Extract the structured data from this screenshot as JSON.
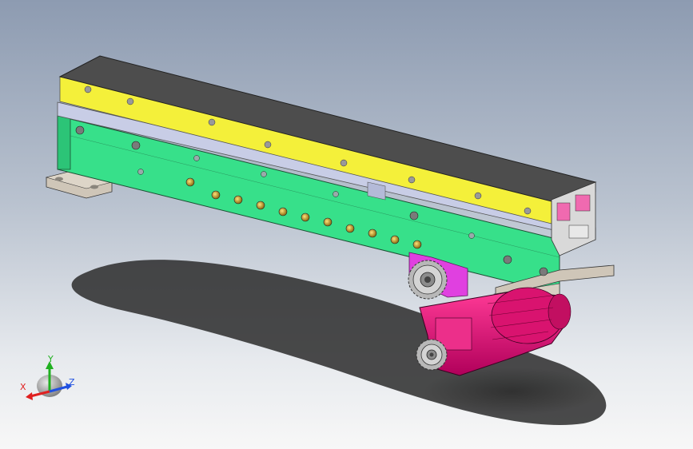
{
  "viewport": {
    "background_top": "#8d9bb1",
    "background_bottom": "#f7f7f7"
  },
  "model": {
    "parts": [
      {
        "name": "top-plate",
        "color": "#4d4d4d"
      },
      {
        "name": "yellow-rail",
        "color": "#f4f03a"
      },
      {
        "name": "light-blue-strip",
        "color": "#c8cde6"
      },
      {
        "name": "green-side-plate",
        "color": "#37e08a"
      },
      {
        "name": "mounting-bracket",
        "color": "#cfc6b8"
      },
      {
        "name": "magenta-bracket",
        "color": "#e040e0"
      },
      {
        "name": "gear-motor",
        "color": "#e8137a"
      },
      {
        "name": "sprocket",
        "color": "#c0c0c0"
      }
    ]
  },
  "triad": {
    "x_label": "X",
    "y_label": "Y",
    "z_label": "Z",
    "x_color": "#e02020",
    "y_color": "#20b020",
    "z_color": "#2050e0"
  }
}
